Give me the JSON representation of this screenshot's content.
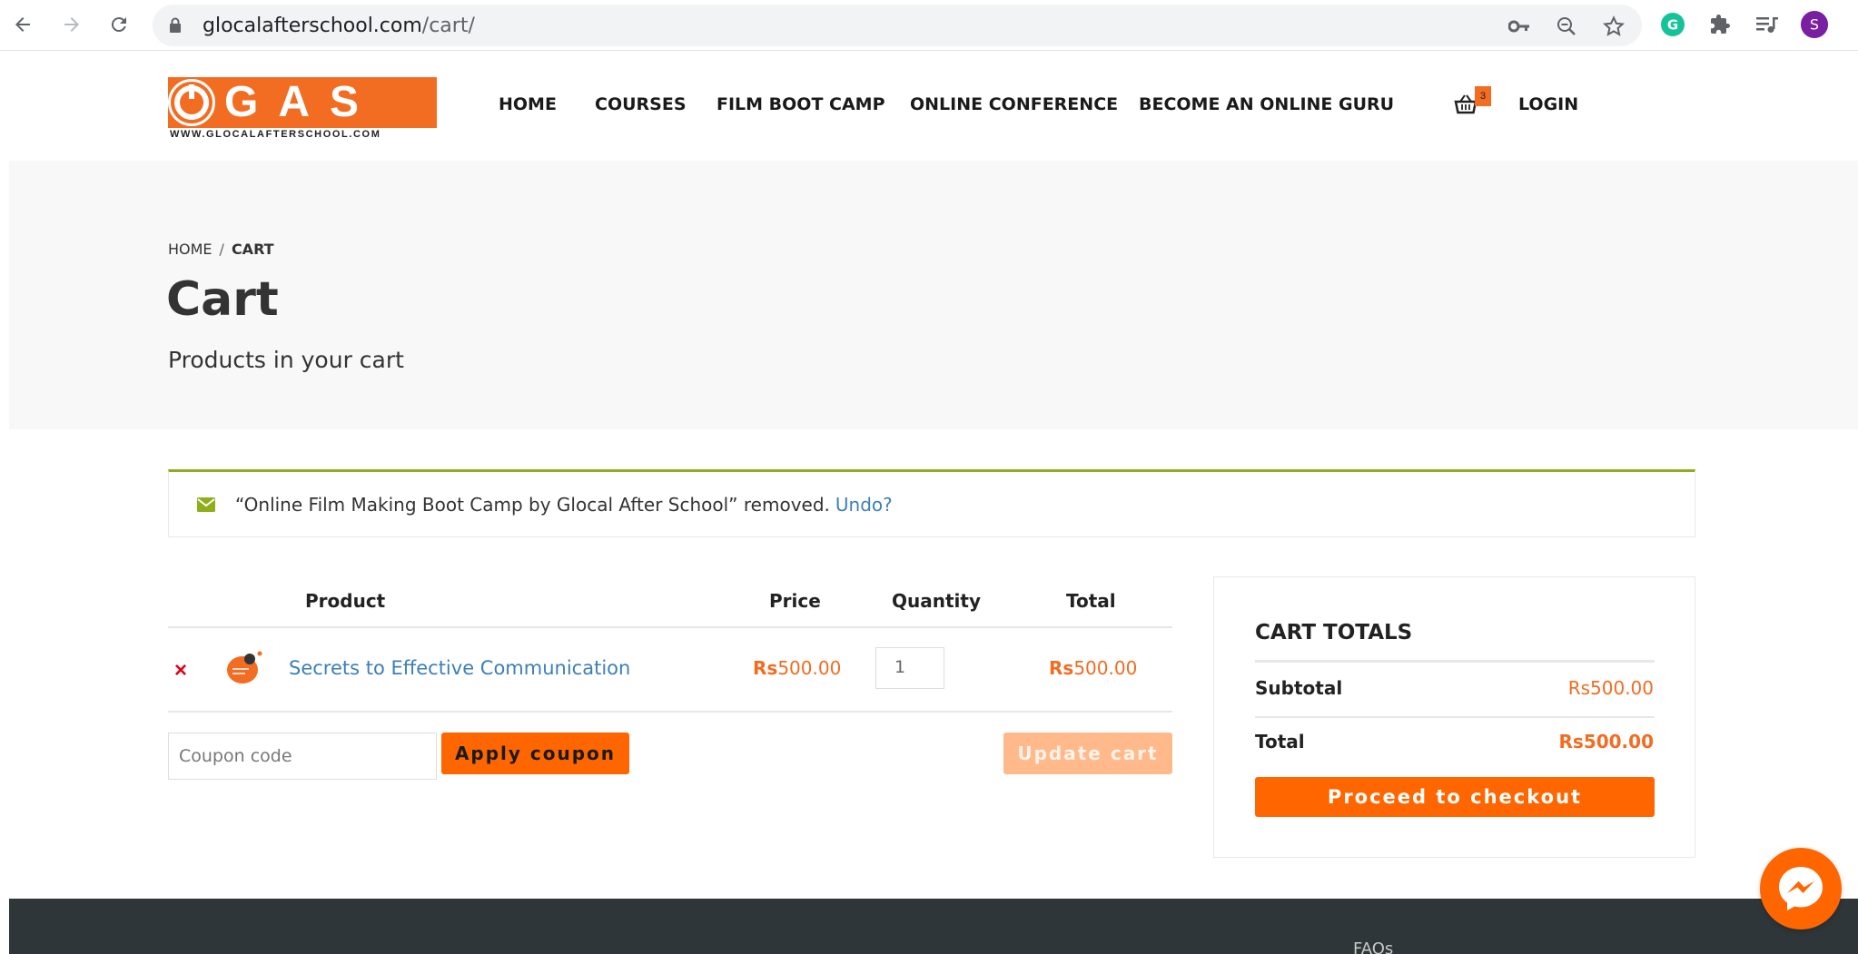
{
  "browser": {
    "url_domain": "glocalafterschool.com",
    "url_path": "/cart/",
    "profile_initial": "S",
    "grammarly_initial": "G"
  },
  "logo": {
    "letters": "GAS",
    "tagline": "WWW.GLOCALAFTERSCHOOL.COM"
  },
  "nav": {
    "home": "HOME",
    "courses": "COURSES",
    "film_boot_camp": "FILM BOOT CAMP",
    "online_conference": "ONLINE CONFERENCE",
    "become_guru": "BECOME AN ONLINE GURU",
    "cart_count": "3",
    "login": "LOGIN"
  },
  "breadcrumb": {
    "home": "HOME",
    "separator": "/",
    "current": "CART"
  },
  "page": {
    "title": "Cart",
    "subtitle": "Products in your cart"
  },
  "notice": {
    "message": "“Online Film Making Boot Camp by Glocal After School” removed.",
    "undo": "Undo?"
  },
  "cart_table": {
    "headers": {
      "product": "Product",
      "price": "Price",
      "quantity": "Quantity",
      "total": "Total"
    },
    "items": [
      {
        "remove": "×",
        "name": "Secrets to Effective Communication",
        "currency": "Rs",
        "price": "500.00",
        "quantity": "1",
        "total": "500.00"
      }
    ],
    "coupon_placeholder": "Coupon code",
    "apply_coupon": "Apply coupon",
    "update_cart": "Update cart"
  },
  "totals": {
    "heading": "CART TOTALS",
    "subtotal_label": "Subtotal",
    "subtotal_currency": "Rs",
    "subtotal_value": "500.00",
    "total_label": "Total",
    "total_currency": "Rs",
    "total_value": "500.00",
    "checkout": "Proceed to checkout"
  },
  "footer": {
    "faqs": "FAQs"
  },
  "colors": {
    "accent": "#ff6600",
    "link": "#3d7fb7",
    "notice_border": "#8fae1b",
    "footer_bg": "#2f3639"
  }
}
